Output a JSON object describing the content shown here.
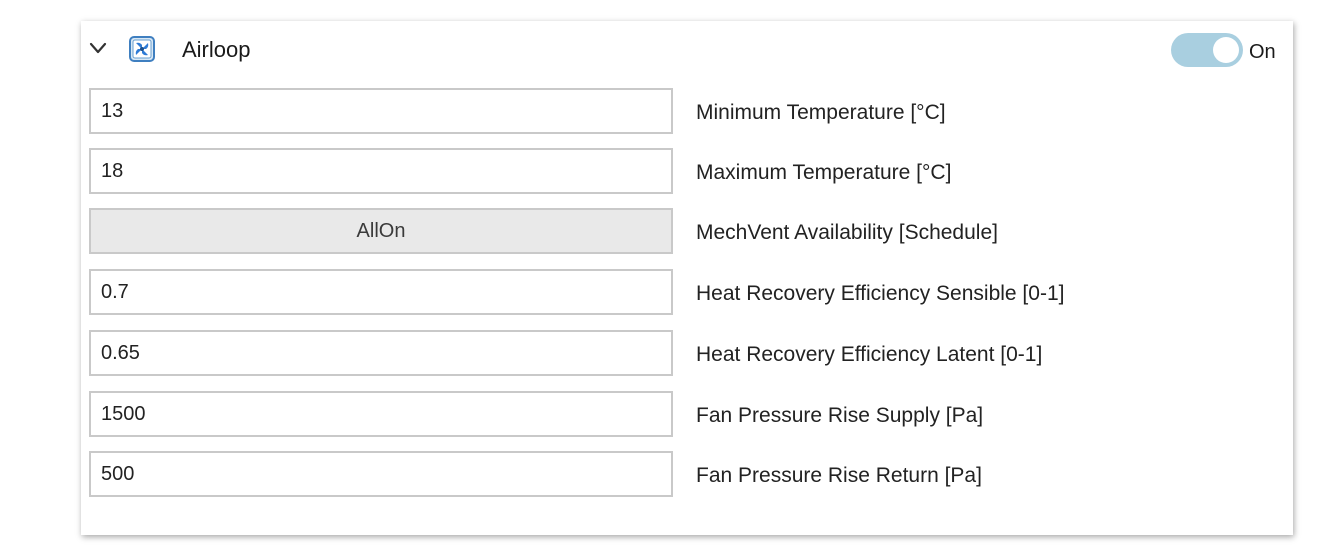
{
  "panel": {
    "title": "Airloop",
    "icon": "fan-icon",
    "collapse_icon": "chevron-down-icon",
    "toggle": {
      "state": "on",
      "label": "On",
      "color": "#a9cfe0"
    }
  },
  "fields": [
    {
      "value": "13",
      "label": "Minimum Temperature [°C]",
      "kind": "text"
    },
    {
      "value": "18",
      "label": "Maximum Temperature [°C]",
      "kind": "text"
    },
    {
      "value": "AllOn",
      "label": "MechVent Availability [Schedule]",
      "kind": "button"
    },
    {
      "value": "0.7",
      "label": "Heat Recovery Efficiency Sensible [0-1]",
      "kind": "text"
    },
    {
      "value": "0.65",
      "label": "Heat Recovery Efficiency Latent [0-1]",
      "kind": "text"
    },
    {
      "value": "1500",
      "label": "Fan Pressure Rise Supply [Pa]",
      "kind": "text"
    },
    {
      "value": "500",
      "label": "Fan Pressure Rise Return [Pa]",
      "kind": "text"
    }
  ]
}
